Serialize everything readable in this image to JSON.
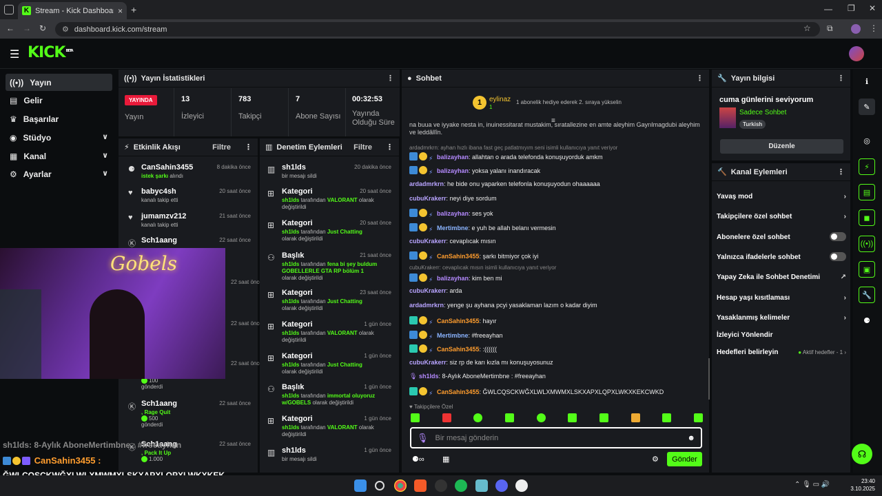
{
  "browser": {
    "tab_title": "Stream - Kick Dashboard",
    "url": "dashboard.kick.com/stream",
    "new_tab": "+",
    "close": "×"
  },
  "header": {
    "logo": "KICK",
    "beta": "BETA"
  },
  "sidebar": {
    "items": [
      {
        "label": "Yayın"
      },
      {
        "label": "Gelir"
      },
      {
        "label": "Başarılar"
      },
      {
        "label": "Stüdyo"
      },
      {
        "label": "Kanal"
      },
      {
        "label": "Ayarlar"
      }
    ]
  },
  "stats": {
    "title": "Yayın İstatistikleri",
    "live_badge": "YAYINDA",
    "live_label": "Yayın",
    "items": [
      {
        "value": "13",
        "label": "İzleyici"
      },
      {
        "value": "783",
        "label": "Takipçi"
      },
      {
        "value": "7",
        "label": "Abone Sayısı"
      },
      {
        "value": "00:32:53",
        "label": "Yayında Olduğu Süre"
      }
    ]
  },
  "events": {
    "title": "Etkinlik Akışı",
    "filter": "Filtre",
    "items": [
      {
        "name": "CanSahin3455",
        "time": "8 dakika önce",
        "sub_green": "istek şarkı",
        "sub": "alındı"
      },
      {
        "name": "babyc4sh",
        "time": "20 saat önce",
        "sub": "kanalı takip etti"
      },
      {
        "name": "jumamzv212",
        "time": "21 saat önce",
        "sub": "kanalı takip etti"
      },
      {
        "name": "Sch1aang",
        "time": "22 saat önce"
      },
      {
        "time": "22 saat önce"
      },
      {
        "time": "22 saat önce"
      },
      {
        "time": "22 saat önce"
      },
      {
        "amount": "100",
        "sub": "gönderdi"
      },
      {
        "name": "Sch1aang",
        "time": "22 saat önce",
        "sub_green": ", Rage Quit",
        "amount": "500",
        "sub": "gönderdi"
      },
      {
        "name": "Sch1aang",
        "time": "22 saat önce",
        "sub_green": ", Pack It Up",
        "amount": "1.000"
      }
    ]
  },
  "mod": {
    "title": "Denetim Eylemleri",
    "filter": "Filtre",
    "items": [
      {
        "name": "sh1lds",
        "time": "20 dakika önce",
        "line1": "bir mesajı sildi"
      },
      {
        "name": "Kategori",
        "time": "20 saat önce",
        "by": "sh1lds",
        "mid": " tarafından ",
        "val": "VALORANT",
        "end": " olarak değiştirildi"
      },
      {
        "name": "Kategori",
        "time": "20 saat önce",
        "by": "sh1lds",
        "mid": " tarafından ",
        "val": "Just Chatting",
        "end": " olarak değiştirildi"
      },
      {
        "name": "Başlık",
        "time": "21 saat önce",
        "by": "sh1lds",
        "mid": " tarafından ",
        "val": "fena bi şey buldum GOBELLERLE GTA RP bölüm 1",
        "end": " olarak değiştirildi"
      },
      {
        "name": "Kategori",
        "time": "23 saat önce",
        "by": "sh1lds",
        "mid": " tarafından ",
        "val": "Just Chatting",
        "end": " olarak değiştirildi"
      },
      {
        "name": "Kategori",
        "time": "1 gün önce",
        "by": "sh1lds",
        "mid": " tarafından ",
        "val": "VALORANT",
        "end": " olarak değiştirildi"
      },
      {
        "name": "Kategori",
        "time": "1 gün önce",
        "by": "sh1lds",
        "mid": " tarafından ",
        "val": "Just Chatting",
        "end": " olarak değiştirildi"
      },
      {
        "name": "Başlık",
        "time": "1 gün önce",
        "by": "sh1lds",
        "mid": " tarafından ",
        "val": "immortal oluyoruz w/GOBELS",
        "end": " olarak değiştirildi"
      },
      {
        "name": "Kategori",
        "time": "1 gün önce",
        "by": "sh1lds",
        "mid": " tarafından ",
        "val": "VALORANT",
        "end": " olarak değiştirildi"
      },
      {
        "name": "sh1lds",
        "time": "1 gün önce",
        "line1": "bir mesajı sildi"
      }
    ]
  },
  "chat": {
    "title": "Sohbet",
    "pin_user": "eylinaz",
    "pin_count": "1",
    "gift_text": "1 abonelik hediye ederek 2. sıraya yükselin",
    "top_text": "na buua ve iyyake nesta in, inuinessitarat mustakim, sıratallezine en amte aleyhim Gayrılmagdubi aleyhim ve leddâllîn.",
    "lines": [
      {
        "reply": "ardadmrkrn: ayhan hızlı ibana fast geç patlatmıyım seni isimli kullanıcıya yanıt veriyor"
      },
      {
        "user": "balizayhan",
        "msg": ": allahtan o arada telefonda konuşuyorduk amkm"
      },
      {
        "user": "balizayhan",
        "msg": ": yoksa yalanı inandıracak"
      },
      {
        "user": "ardadmrkrn",
        "msg": ": he bide onu yaparken telefonla konuşuyodun ohaaaaaa"
      },
      {
        "user": "cubuKrakerr",
        "msg": ": neyi diye sordum"
      },
      {
        "user": "balizayhan",
        "msg": ": ses yok"
      },
      {
        "user": "Mertimbne",
        "msg": ": e yuh be allah belanı vermesin"
      },
      {
        "user": "cubuKrakerr",
        "msg": ": cevaplıcak mısın"
      },
      {
        "user": "CanSahin3455",
        "msg": ": şarkı bitmiyor çok iyi"
      },
      {
        "reply": "cubuKrakerr: cevaplıcak mısın isimli kullanıcıya yanıt veriyor"
      },
      {
        "user": "balizayhan",
        "msg": ": kim ben mi"
      },
      {
        "user": "cubuKrakerr",
        "msg": ": arda"
      },
      {
        "user": "ardadmrkrn",
        "msg": ": yenge şu ayhana pcyi yasaklaman lazım o kadar diyim"
      },
      {
        "user": "CanSahin3455",
        "msg": ": hayır"
      },
      {
        "user": "Mertimbne",
        "msg": ": #freeayhan"
      },
      {
        "user": "CanSahin3455",
        "msg": ": :(((((("
      },
      {
        "user": "cubuKrakerr",
        "msg": ": siz rp de karı kızla mı konuşuyosunuz"
      },
      {
        "user": "sh1lds",
        "msg": ": 8-Aylık AboneMertimbne : #freeayhan"
      },
      {
        "user": "CanSahin3455",
        "msg": ": ĞWLCQSCKWĞXLWLXMWMXLSKXAPXLQPXLWKXKEKCWKD"
      }
    ],
    "followers_only": "Takipçilere Özel",
    "placeholder": "Bir mesaj gönderin",
    "send": "Gönder"
  },
  "stream_info": {
    "title": "Yayın bilgisi",
    "stream_title": "cuma günlerini seviyorum",
    "category": "Sadece Sohbet",
    "tag": "Turkish",
    "edit": "Düzenle"
  },
  "channel_actions": {
    "title": "Kanal Eylemleri",
    "items": [
      {
        "label": "Yavaş mod"
      },
      {
        "label": "Takipçilere özel sohbet"
      },
      {
        "label": "Abonelere özel sohbet"
      },
      {
        "label": "Yalnızca ifadelerle sohbet"
      },
      {
        "label": "Yapay Zeka ile Sohbet Denetimi"
      },
      {
        "label": "Hesap yaşı kısıtlaması"
      },
      {
        "label": "Yasaklanmış kelimeler"
      },
      {
        "label": "İzleyici Yönlendir"
      },
      {
        "label": "Hedefleri belirleyin"
      }
    ],
    "goals_status": "Aktif hedefler - 1"
  },
  "overlay": {
    "neon_text": "Gobels",
    "chat_line1": "sh1lds: 8-Aylık AboneMertimbne : #freeayhan",
    "chat_user": "CanSahin3455 :",
    "chat_msg": "ĞWLCQSCKWĞXLWLXMWMXLSKXAPXLQPXLWKXKEK CWKD"
  },
  "taskbar": {
    "time": "23:40",
    "date": "3.10.2025"
  },
  "colors": {
    "accent": "#53fc18",
    "bg": "#0b0d0f",
    "panel": "#191b1f"
  }
}
